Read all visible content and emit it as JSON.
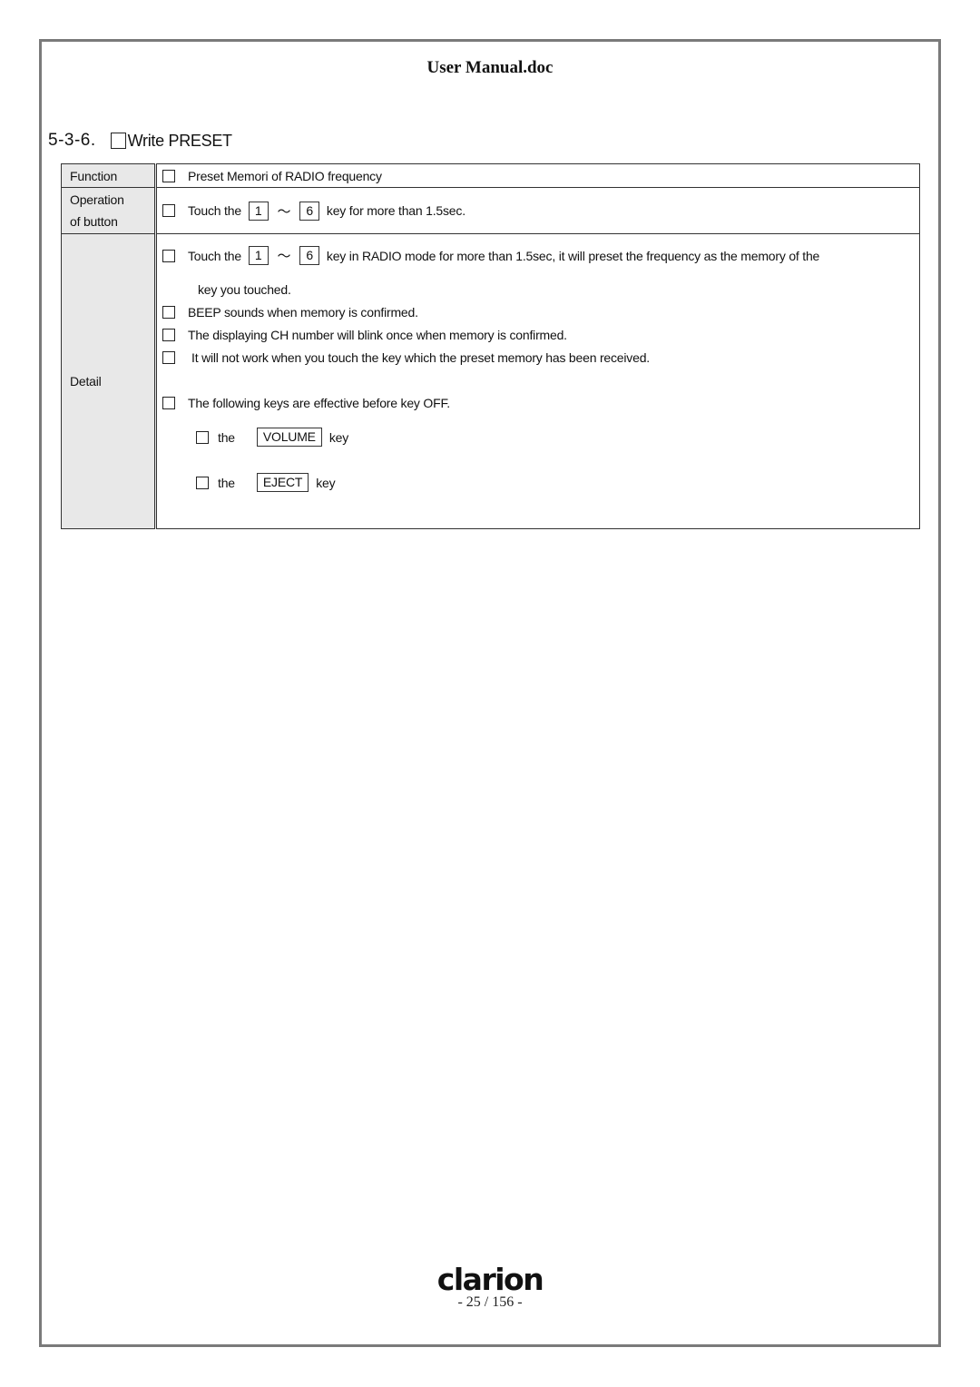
{
  "document": {
    "title": "User Manual.doc",
    "section_number": "5-3-6.",
    "section_title": "Write PRESET"
  },
  "table": {
    "function": {
      "label": "Function",
      "text": "Preset Memori of RADIO frequency"
    },
    "operation": {
      "label_line1": "Operation",
      "label_line2": "of button",
      "prefix": "Touch the",
      "key_from": "1",
      "range_symbol": "～",
      "key_to": "6",
      "suffix": "key for more than 1.5sec."
    },
    "detail": {
      "label": "Detail",
      "item1_prefix": "Touch the",
      "item1_key_from": "1",
      "item1_range_symbol": "～",
      "item1_key_to": "6",
      "item1_suffix": "key in RADIO mode for more than 1.5sec, it will preset the frequency as the memory of the",
      "item1_continuation": "key you touched.",
      "item2": "BEEP sounds when memory is confirmed.",
      "item3": "The displaying CH number will blink once when memory is confirmed.",
      "item4": " It will not work when you touch the key which the preset memory has been received.",
      "item5": "The following keys are effective before key OFF.",
      "sub_items": [
        {
          "prefix": "the",
          "key": "VOLUME",
          "suffix": "key"
        },
        {
          "prefix": "the",
          "key": "EJECT",
          "suffix": "key"
        }
      ]
    }
  },
  "footer": {
    "logo": "clarion",
    "page_number": "- 25 / 156 -"
  }
}
